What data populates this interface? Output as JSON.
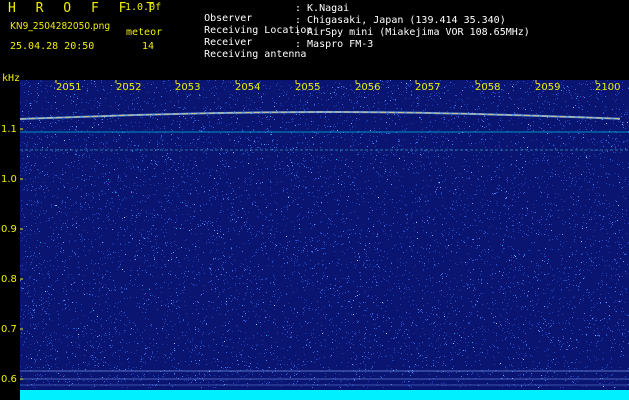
{
  "header": {
    "title": "H R O F F T",
    "version": "1.0.0f",
    "filename": "KN9_2504282050.png",
    "mode": "meteor",
    "datetime": "25.04.28 20:50",
    "count": "14"
  },
  "info": {
    "observer_label": "Observer",
    "observer_value": ": K.Nagai",
    "location_label": "Receiving Location",
    "location_value": ": Chigasaki, Japan (139.414 35.340)",
    "receiver_label": "Receiver",
    "receiver_value": ": AirSpy mini (Miakejima VOR 108.65MHz)",
    "antenna_label": "Receiving antenna",
    "antenna_value": ": Maspro FM-3"
  },
  "axis": {
    "unit": "kHz",
    "y_ticks": [
      "1.1",
      "1.0",
      "0.9",
      "0.8",
      "0.7",
      "0.6"
    ],
    "x_ticks": [
      "2051",
      "2052",
      "2053",
      "2054",
      "2055",
      "2056",
      "2057",
      "2058",
      "2059",
      "2100"
    ]
  },
  "colors": {
    "background": "#0a1572",
    "label": "#f0f000",
    "signal_bright": "#ffd060",
    "line_cyan": "#00e0ff",
    "bottom_band": "#00f0ff"
  }
}
